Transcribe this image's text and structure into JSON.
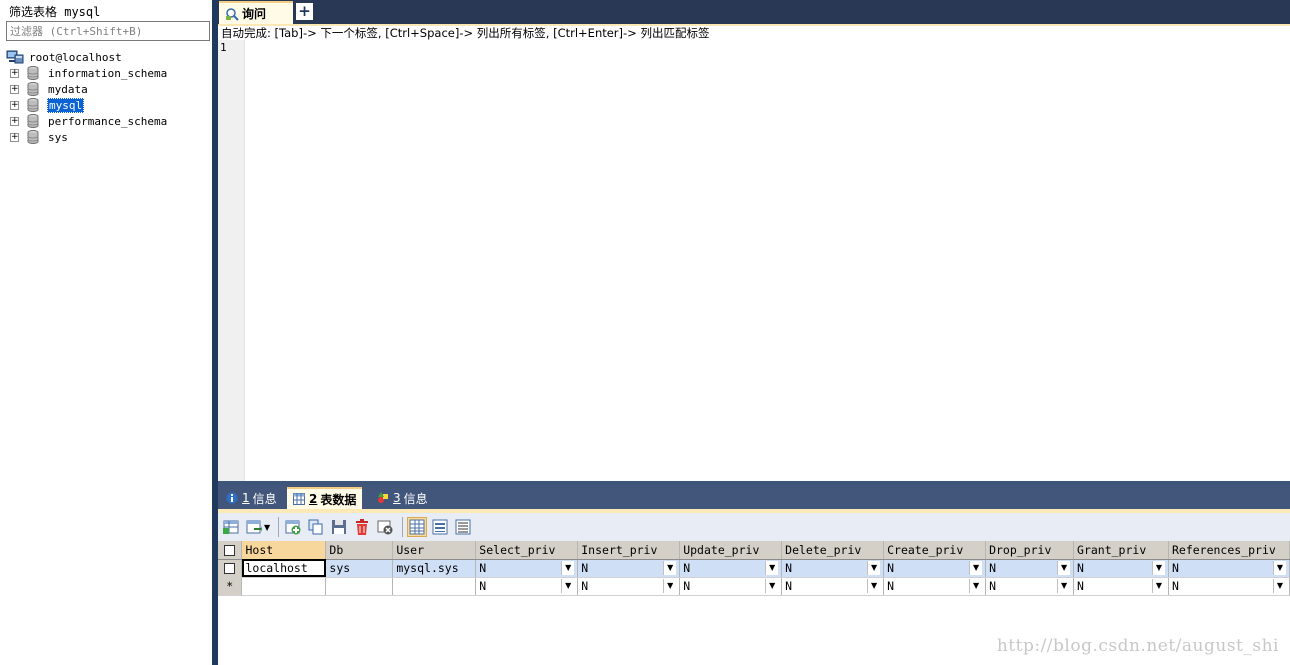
{
  "left_panel": {
    "filter_label": "筛选表格 mysql",
    "filter_placeholder": "过滤器 (Ctrl+Shift+B)",
    "tree": {
      "root_label": "root@localhost",
      "databases": [
        "information_schema",
        "mydata",
        "mysql",
        "performance_schema",
        "sys"
      ],
      "selected": "mysql"
    }
  },
  "editor": {
    "tab_label": "询问",
    "add_tab_symbol": "+",
    "autocomplete_hint": "自动完成: [Tab]-> 下一个标签, [Ctrl+Space]-> 列出所有标签, [Ctrl+Enter]-> 列出匹配标签",
    "line_number": "1"
  },
  "results": {
    "tabs": [
      {
        "num": "1",
        "label": "信息",
        "active": false
      },
      {
        "num": "2",
        "label": "表数据",
        "active": true
      },
      {
        "num": "3",
        "label": "信息",
        "active": false
      }
    ],
    "grid": {
      "columns": [
        "Host",
        "Db",
        "User",
        "Select_priv",
        "Insert_priv",
        "Update_priv",
        "Delete_priv",
        "Create_priv",
        "Drop_priv",
        "Grant_priv",
        "References_priv"
      ],
      "rows": [
        [
          "localhost",
          "sys",
          "mysql.sys",
          "N",
          "N",
          "N",
          "N",
          "N",
          "N",
          "N",
          "N"
        ]
      ],
      "new_row_marker": "*",
      "new_row_defaults": [
        "",
        "",
        "",
        "N",
        "N",
        "N",
        "N",
        "N",
        "N",
        "N",
        "N"
      ]
    }
  },
  "watermark": "http://blog.csdn.net/august_shi",
  "colors": {
    "selection": "#0a62d3",
    "tab_strip": "#293955",
    "active_tab": "#fffbe6",
    "row_highlight": "#cfdff5"
  }
}
